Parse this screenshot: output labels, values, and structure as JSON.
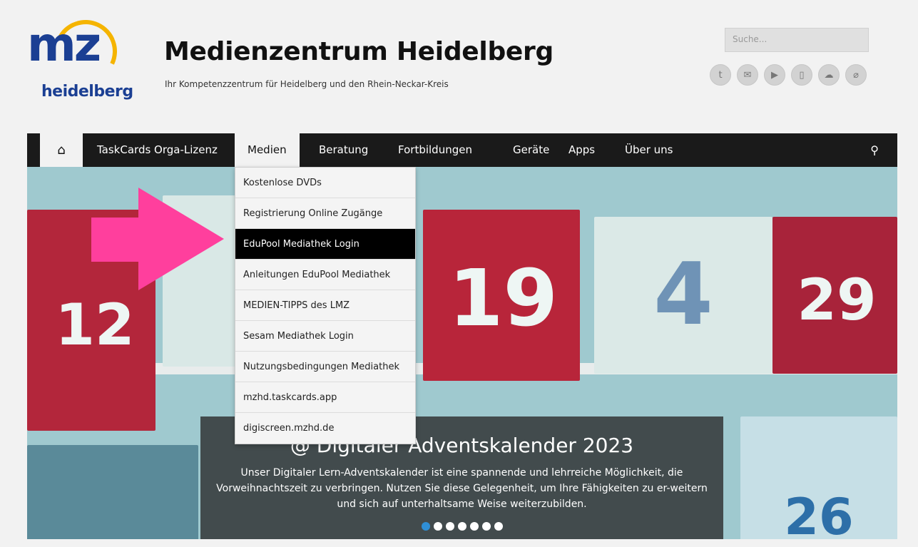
{
  "logo": {
    "mark": "mz",
    "subtitle": "heidelberg"
  },
  "site": {
    "title": "Medienzentrum Heidelberg",
    "tagline": "Ihr Kompetenzzentrum für Heidelberg und den Rhein-Neckar-Kreis"
  },
  "search": {
    "placeholder": "Suche..."
  },
  "social": [
    {
      "icon": "twitter-icon",
      "glyph": "t"
    },
    {
      "icon": "mail-icon",
      "glyph": "✉"
    },
    {
      "icon": "youtube-icon",
      "glyph": "▶"
    },
    {
      "icon": "mobile-icon",
      "glyph": "▯"
    },
    {
      "icon": "cloud-icon",
      "glyph": "☁"
    },
    {
      "icon": "paperclip-icon",
      "glyph": "⌀"
    }
  ],
  "nav": {
    "home_icon": "⌂",
    "items": [
      "TaskCards Orga-Lizenz",
      "Medien",
      "Beratung",
      "Fortbildungen",
      "Geräte",
      "Apps",
      "Über uns"
    ],
    "active": "Medien",
    "search_icon": "⚲"
  },
  "dropdown": {
    "items": [
      "Kostenlose DVDs",
      "Registrierung Online Zugänge",
      "EduPool Mediathek Login",
      "Anleitungen EduPool Mediathek",
      "MEDIEN-TIPPS des LMZ",
      "Sesam Mediathek Login",
      "Nutzungsbedingungen Mediathek",
      "mzhd.taskcards.app",
      "digiscreen.mzhd.de"
    ],
    "highlighted": "EduPool Mediathek Login"
  },
  "slider": {
    "title": "@ Digitaler Adventskalender 2023",
    "text": "Unser Digitaler Lern-Adventskalender ist eine spannende und lehrreiche Möglichkeit, die Vorweihnachtszeit zu verbringen. Nutzen Sie diese Gelegenheit, um Ihre Fähigkeiten zu er-weitern und sich auf unterhaltsame Weise weiterzubilden.",
    "dot_count": 7,
    "active_dot": 0,
    "house_numbers": [
      "12",
      "19",
      "4",
      "29",
      "26"
    ]
  },
  "colors": {
    "brand_blue": "#1b3f93",
    "brand_yellow": "#f5b400",
    "nav_bg": "#1a1a1a",
    "arrow_pink": "#ff3f9d",
    "active_dot": "#2f8fd6"
  }
}
